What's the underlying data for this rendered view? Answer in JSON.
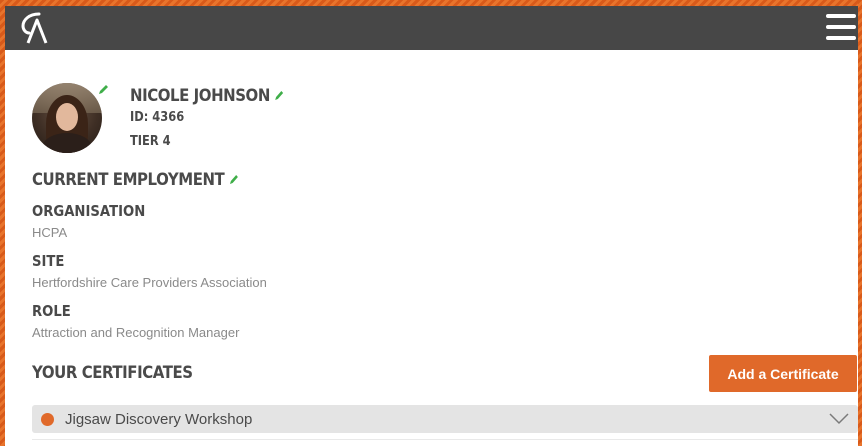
{
  "profile": {
    "name": "NICOLE JOHNSON",
    "id": "ID: 4366",
    "tier": "TIER 4"
  },
  "employment": {
    "title": "CURRENT EMPLOYMENT",
    "organisation_label": "ORGANISATION",
    "organisation_value": "HCPA",
    "site_label": "SITE",
    "site_value": "Hertfordshire Care Providers Association",
    "role_label": "ROLE",
    "role_value": "Attraction and Recognition Manager"
  },
  "certificates": {
    "title": "YOUR CERTIFICATES",
    "add_label": "Add a Certificate",
    "items": [
      {
        "name": "Jigsaw Discovery Workshop",
        "status_color": "#e0692a"
      }
    ]
  },
  "icons": {
    "logo": "ca-logo",
    "menu": "hamburger-menu-icon",
    "edit": "pencil-icon",
    "expand": "chevron-down-icon"
  },
  "colors": {
    "accent": "#e0692a",
    "topbar": "#474747",
    "edit_icon": "#3fae49",
    "frame": "#e2631f"
  }
}
